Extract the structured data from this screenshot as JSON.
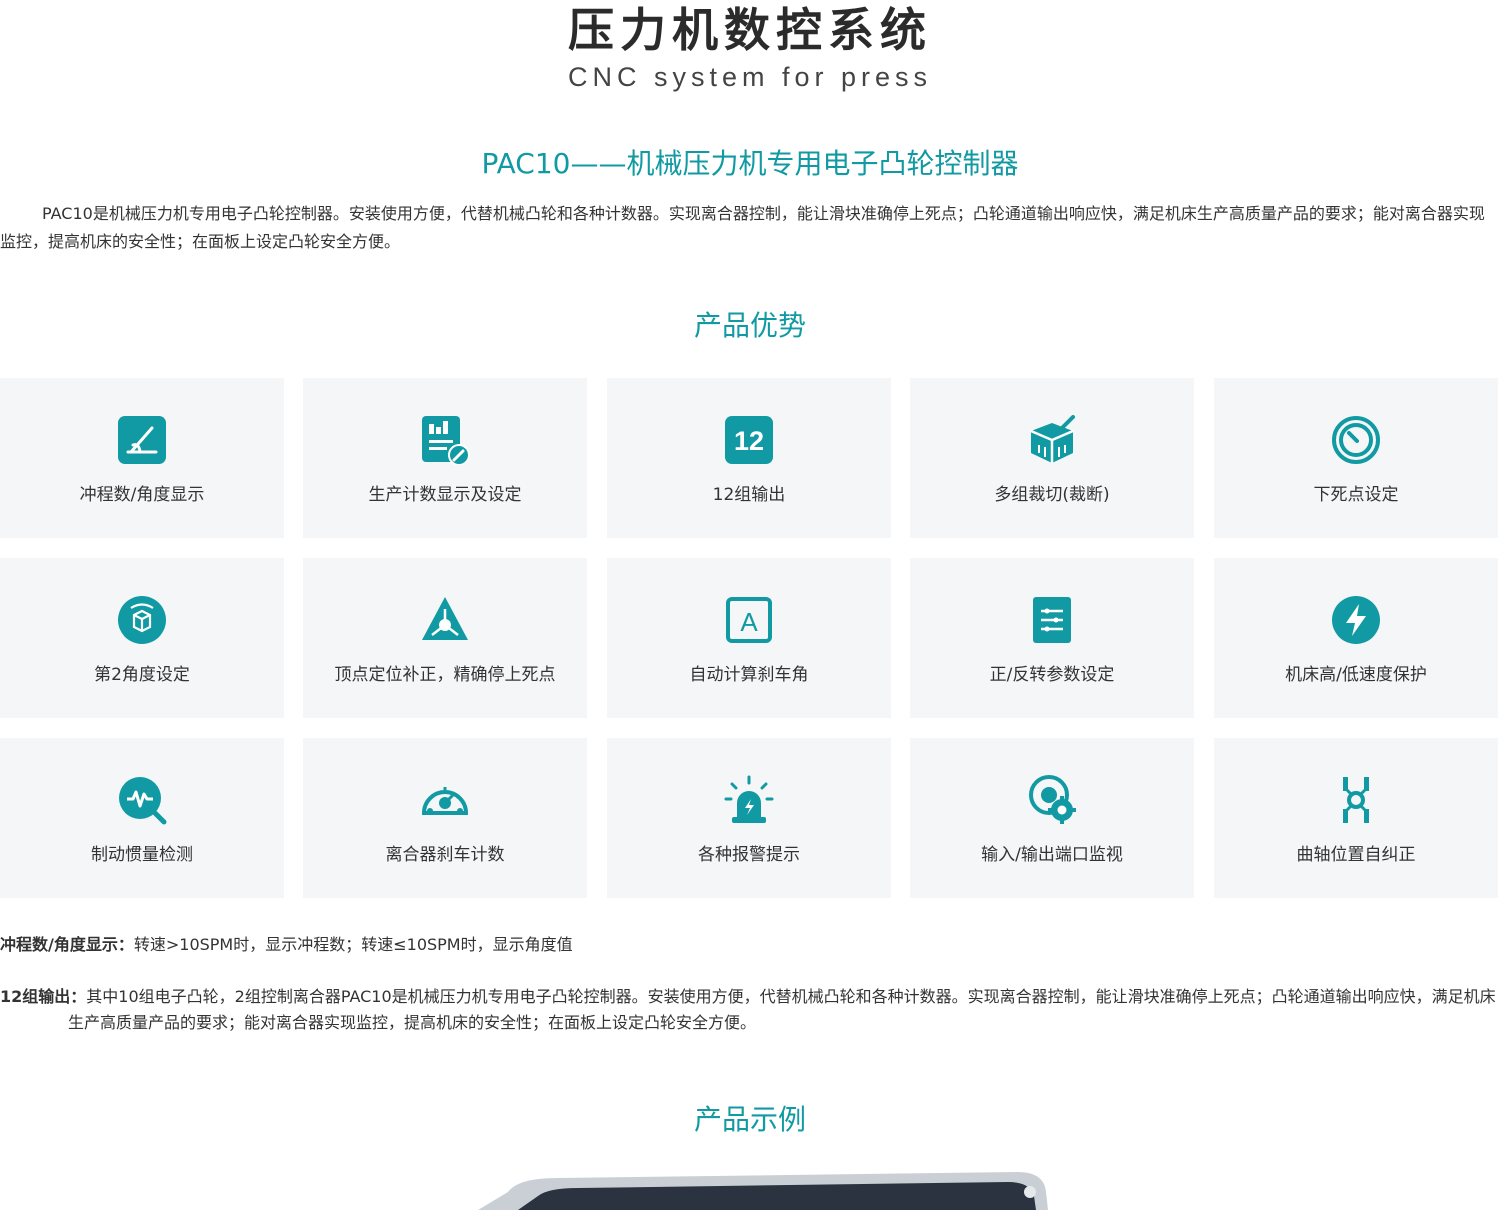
{
  "header": {
    "title": "压力机数控系统",
    "subtitle": "CNC system for press"
  },
  "product": {
    "heading": "PAC10——机械压力机专用电子凸轮控制器",
    "intro": "PAC10是机械压力机专用电子凸轮控制器。安装使用方便，代替机械凸轮和各种计数器。实现离合器控制，能让滑块准确停上死点；凸轮通道输出响应快，满足机床生产高质量产品的要求；能对离合器实现监控，提高机床的安全性；在面板上设定凸轮安全方便。"
  },
  "advantages": {
    "heading": "产品优势",
    "items": [
      {
        "label": "冲程数/角度显示",
        "icon": "angle-icon"
      },
      {
        "label": "生产计数显示及设定",
        "icon": "report-edit-icon"
      },
      {
        "label": "12组输出",
        "icon": "number-12-icon"
      },
      {
        "label": "多组裁切(裁断)",
        "icon": "box-cut-icon"
      },
      {
        "label": "下死点设定",
        "icon": "gauge-circle-icon"
      },
      {
        "label": "第2角度设定",
        "icon": "rotate-box-icon"
      },
      {
        "label": "顶点定位补正，精确停上死点",
        "icon": "triangle-target-icon"
      },
      {
        "label": "自动计算刹车角",
        "icon": "letter-a-cycle-icon"
      },
      {
        "label": "正/反转参数设定",
        "icon": "settings-list-icon"
      },
      {
        "label": "机床高/低速度保护",
        "icon": "lightning-icon"
      },
      {
        "label": "制动惯量检测",
        "icon": "pulse-search-icon"
      },
      {
        "label": "离合器刹车计数",
        "icon": "dashboard-icon"
      },
      {
        "label": "各种报警提示",
        "icon": "alarm-light-icon"
      },
      {
        "label": "输入/输出端口监视",
        "icon": "gear-monitor-icon"
      },
      {
        "label": "曲轴位置自纠正",
        "icon": "crankshaft-icon"
      }
    ]
  },
  "details": [
    {
      "key": "冲程数/角度显示：",
      "text": "转速>10SPM时，显示冲程数；转速≤10SPM时，显示角度值"
    },
    {
      "key": "12组输出：",
      "text": "其中10组电子凸轮，2组控制离合器PAC10是机械压力机专用电子凸轮控制器。安装使用方便，代替机械凸轮和各种计数器。实现离合器控制，能让滑块准确停上死点；凸轮通道输出响应快，满足机床生产高质量产品的要求；能对离合器实现监控，提高机床的安全性；在面板上设定凸轮安全方便。"
    }
  ],
  "examples": {
    "heading": "产品示例"
  },
  "colors": {
    "accent": "#119aa3",
    "card_bg": "#f4f6f7",
    "text": "#333333"
  }
}
